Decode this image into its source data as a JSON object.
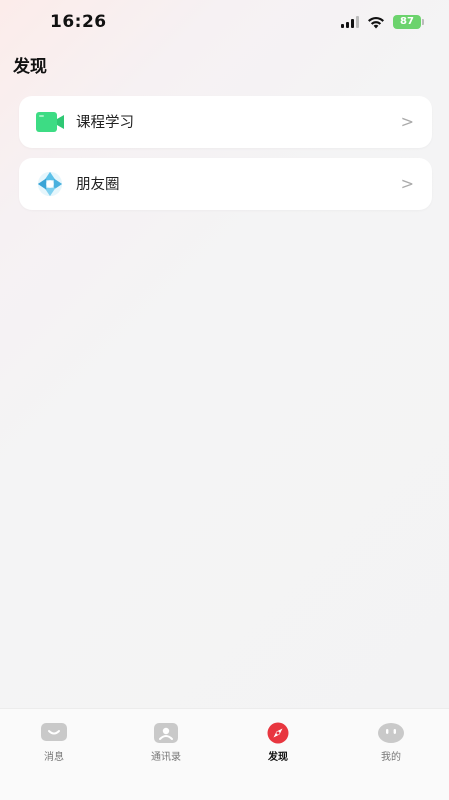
{
  "status_bar": {
    "time": "16:26",
    "battery": "87"
  },
  "page": {
    "title": "发现"
  },
  "items": [
    {
      "label": "课程学习",
      "icon": "video-camera-icon",
      "accent": "#3ddc84"
    },
    {
      "label": "朋友圈",
      "icon": "aperture-icon",
      "accent": "#5bc0e8"
    }
  ],
  "tabbar": {
    "tabs": [
      {
        "label": "消息",
        "icon": "message-icon"
      },
      {
        "label": "通讯录",
        "icon": "contacts-icon"
      },
      {
        "label": "发现",
        "icon": "compass-icon",
        "active": true
      },
      {
        "label": "我的",
        "icon": "profile-icon"
      }
    ],
    "active_color": "#e8363f"
  }
}
